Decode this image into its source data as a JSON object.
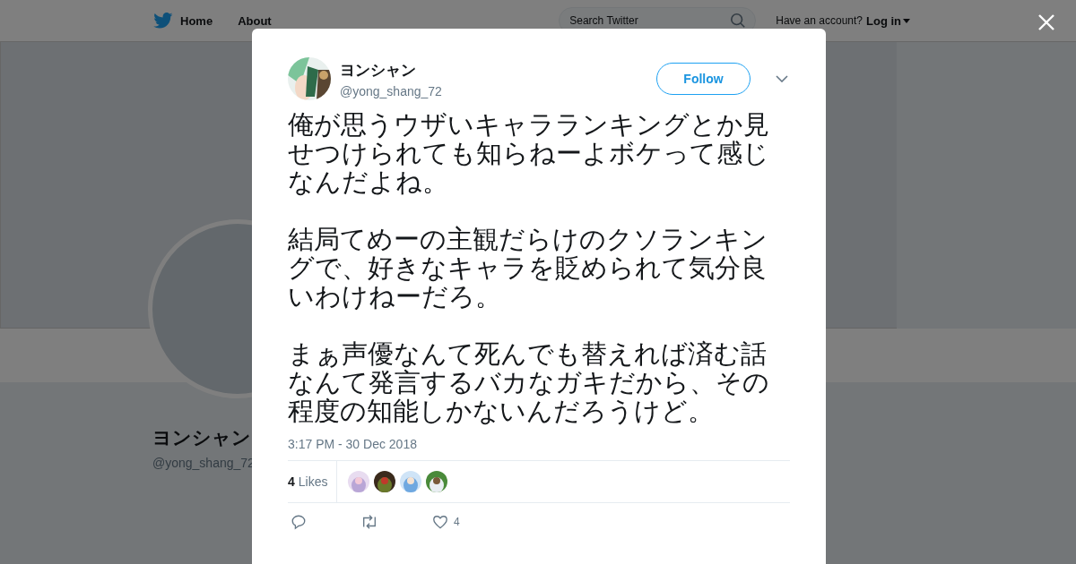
{
  "nav": {
    "items": [
      {
        "label": "Home"
      },
      {
        "label": "About"
      }
    ],
    "search": {
      "placeholder": "Search Twitter"
    },
    "account_prompt": "Have an account?",
    "login": "Log in"
  },
  "profile": {
    "name": "ヨンシャン",
    "handle": "@yong_shang_72"
  },
  "tweet": {
    "name": "ヨンシャン",
    "handle": "@yong_shang_72",
    "follow": "Follow",
    "paragraphs": [
      "俺が思うウザいキャラランキングとか見せつけられても知らねーよボケって感じなんだよね。",
      "結局てめーの主観だらけのクソランキングで、好きなキャラを貶められて気分良いわけねーだろ。",
      "まぁ声優なんて死んでも替えれば済む話なんて発言するバカなガキだから、その程度の知能しかないんだろうけど。"
    ],
    "timestamp": "3:17 PM - 30 Dec 2018",
    "likes_count": "4",
    "likes_label": "Likes",
    "likers": [
      {
        "kind": "picture"
      },
      {
        "kind": "picture"
      },
      {
        "kind": "picture"
      },
      {
        "kind": "picture"
      }
    ],
    "like_action_count": "4"
  }
}
